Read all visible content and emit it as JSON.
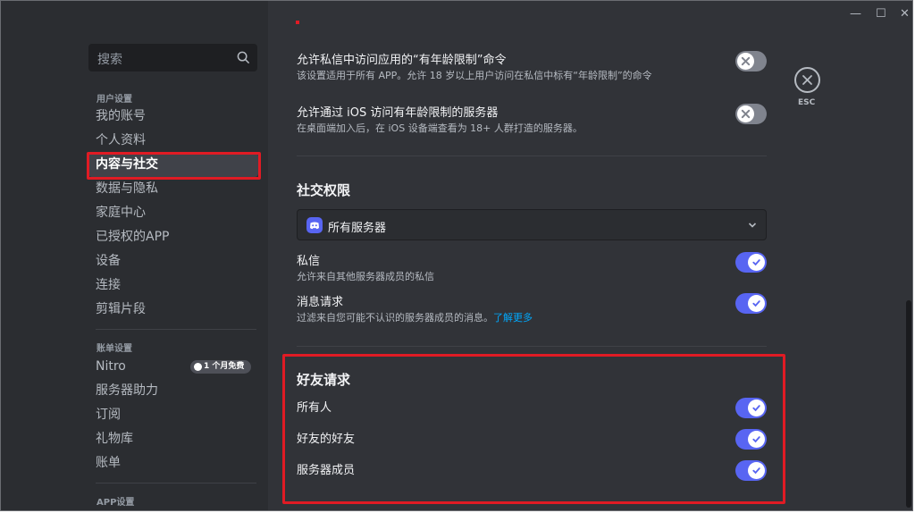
{
  "window_controls": {
    "minimize": "—",
    "maximize": "☐",
    "close": "✕"
  },
  "sidebar": {
    "search_placeholder": "搜索",
    "user_settings_header": "用户设置",
    "user_items": [
      "我的账号",
      "个人资料",
      "内容与社交",
      "数据与隐私",
      "家庭中心",
      "已授权的APP",
      "设备",
      "连接",
      "剪辑片段"
    ],
    "active_item": "内容与社交",
    "billing_header": "账单设置",
    "billing_items": [
      "Nitro",
      "服务器助力",
      "订阅",
      "礼物库",
      "账单"
    ],
    "nitro_badge": "1 个月免费",
    "app_header": "APP设置"
  },
  "content": {
    "age_dm": {
      "title": "允许私信中访问应用的“有年龄限制”命令",
      "desc": "该设置适用于所有 APP。允许 18 岁以上用户访问在私信中标有“年龄限制”的命令",
      "enabled": false
    },
    "age_ios": {
      "title": "允许通过 iOS 访问有年龄限制的服务器",
      "desc": "在桌面端加入后，在 iOS 设备端查看为 18+ 人群打造的服务器。",
      "enabled": false
    },
    "social": {
      "heading": "社交权限",
      "dropdown_value": "所有服务器",
      "dm_title": "私信",
      "dm_desc": "允许来自其他服务器成员的私信",
      "dm_enabled": true,
      "req_title": "消息请求",
      "req_desc": "过滤来自您可能不认识的服务器成员的消息。",
      "req_link": "了解更多",
      "req_enabled": true
    },
    "friend_requests": {
      "heading": "好友请求",
      "everyone": "所有人",
      "friends_of_friends": "好友的好友",
      "server_members": "服务器成员",
      "everyone_enabled": true,
      "fof_enabled": true,
      "members_enabled": true
    }
  },
  "close": {
    "label": "ESC"
  },
  "colors": {
    "accent": "#5865f2",
    "highlight": "#e01b24",
    "link": "#00a8fc"
  }
}
